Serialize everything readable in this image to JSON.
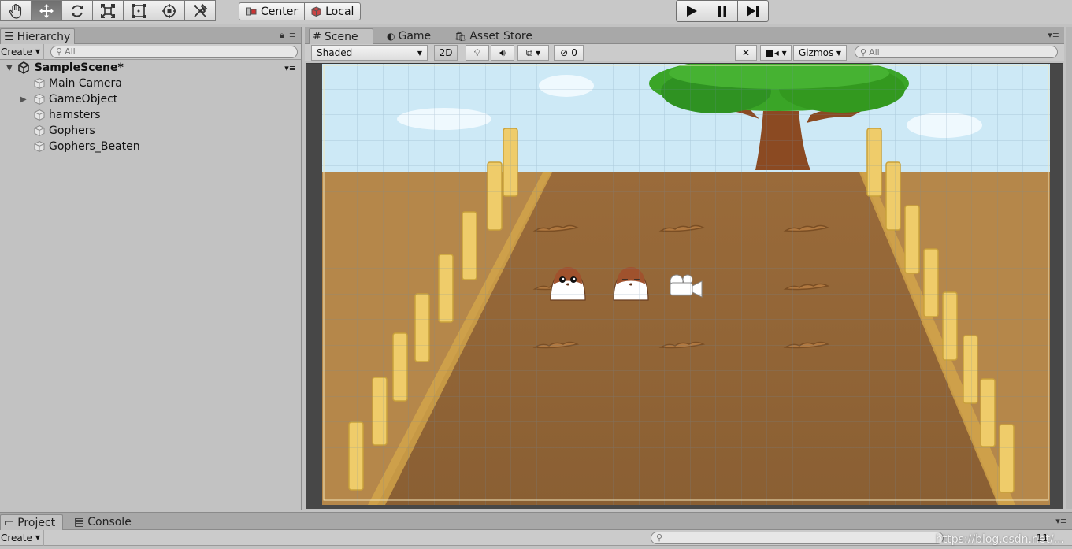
{
  "toolbar": {
    "tools": [
      "hand-tool",
      "move-tool",
      "rotate-tool",
      "scale-tool",
      "rect-tool",
      "transform-tool",
      "custom-tool"
    ],
    "active_tool": "move-tool",
    "pivot_label": "Center",
    "space_label": "Local"
  },
  "hierarchy": {
    "tab_label": "Hierarchy",
    "create_label": "Create",
    "search_placeholder": "All",
    "scene_name": "SampleScene*",
    "items": [
      {
        "label": "Main Camera",
        "expandable": false
      },
      {
        "label": "GameObject",
        "expandable": true
      },
      {
        "label": "hamsters",
        "expandable": false
      },
      {
        "label": "Gophers",
        "expandable": false
      },
      {
        "label": "Gophers_Beaten",
        "expandable": false
      }
    ]
  },
  "scene": {
    "tabs": [
      {
        "label": "Scene",
        "icon": "grid-icon",
        "active": true
      },
      {
        "label": "Game",
        "icon": "pacman-icon",
        "active": false
      },
      {
        "label": "Asset Store",
        "icon": "store-icon",
        "active": false
      }
    ],
    "shading_mode": "Shaded",
    "mode_2d": "2D",
    "hidden_count": "0",
    "gizmos_label": "Gizmos",
    "search_placeholder": "All"
  },
  "project": {
    "tabs": [
      {
        "label": "Project",
        "active": true
      },
      {
        "label": "Console",
        "active": false
      }
    ],
    "create_label": "Create",
    "layer_count": "11"
  },
  "watermark": "https://blog.csdn.net/..."
}
